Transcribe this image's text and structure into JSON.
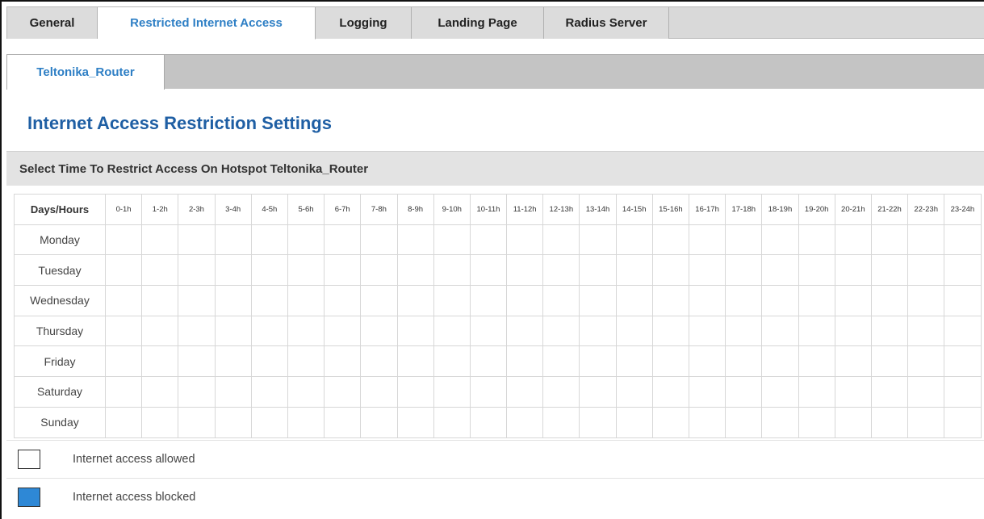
{
  "tabs": [
    {
      "label": "General",
      "active": false
    },
    {
      "label": "Restricted Internet Access",
      "active": true
    },
    {
      "label": "Logging",
      "active": false
    },
    {
      "label": "Landing Page",
      "active": false
    },
    {
      "label": "Radius Server",
      "active": false
    }
  ],
  "subtab": {
    "label": "Teltonika_Router"
  },
  "section_title": "Internet Access Restriction Settings",
  "select_bar": "Select Time To Restrict Access On Hotspot Teltonika_Router",
  "schedule": {
    "corner_header": "Days/Hours",
    "hours": [
      "0-1h",
      "1-2h",
      "2-3h",
      "3-4h",
      "4-5h",
      "5-6h",
      "6-7h",
      "7-8h",
      "8-9h",
      "9-10h",
      "10-11h",
      "11-12h",
      "12-13h",
      "13-14h",
      "14-15h",
      "15-16h",
      "16-17h",
      "17-18h",
      "18-19h",
      "19-20h",
      "20-21h",
      "21-22h",
      "22-23h",
      "23-24h"
    ],
    "days": [
      "Monday",
      "Tuesday",
      "Wednesday",
      "Thursday",
      "Friday",
      "Saturday",
      "Sunday"
    ],
    "blocked_cells": []
  },
  "legend": {
    "allowed_label": "Internet access allowed",
    "blocked_label": "Internet access blocked"
  },
  "colors": {
    "accent": "#2e7fc5",
    "blocked": "#2e88d6",
    "allowed": "#ffffff",
    "title": "#1f5fa4"
  }
}
